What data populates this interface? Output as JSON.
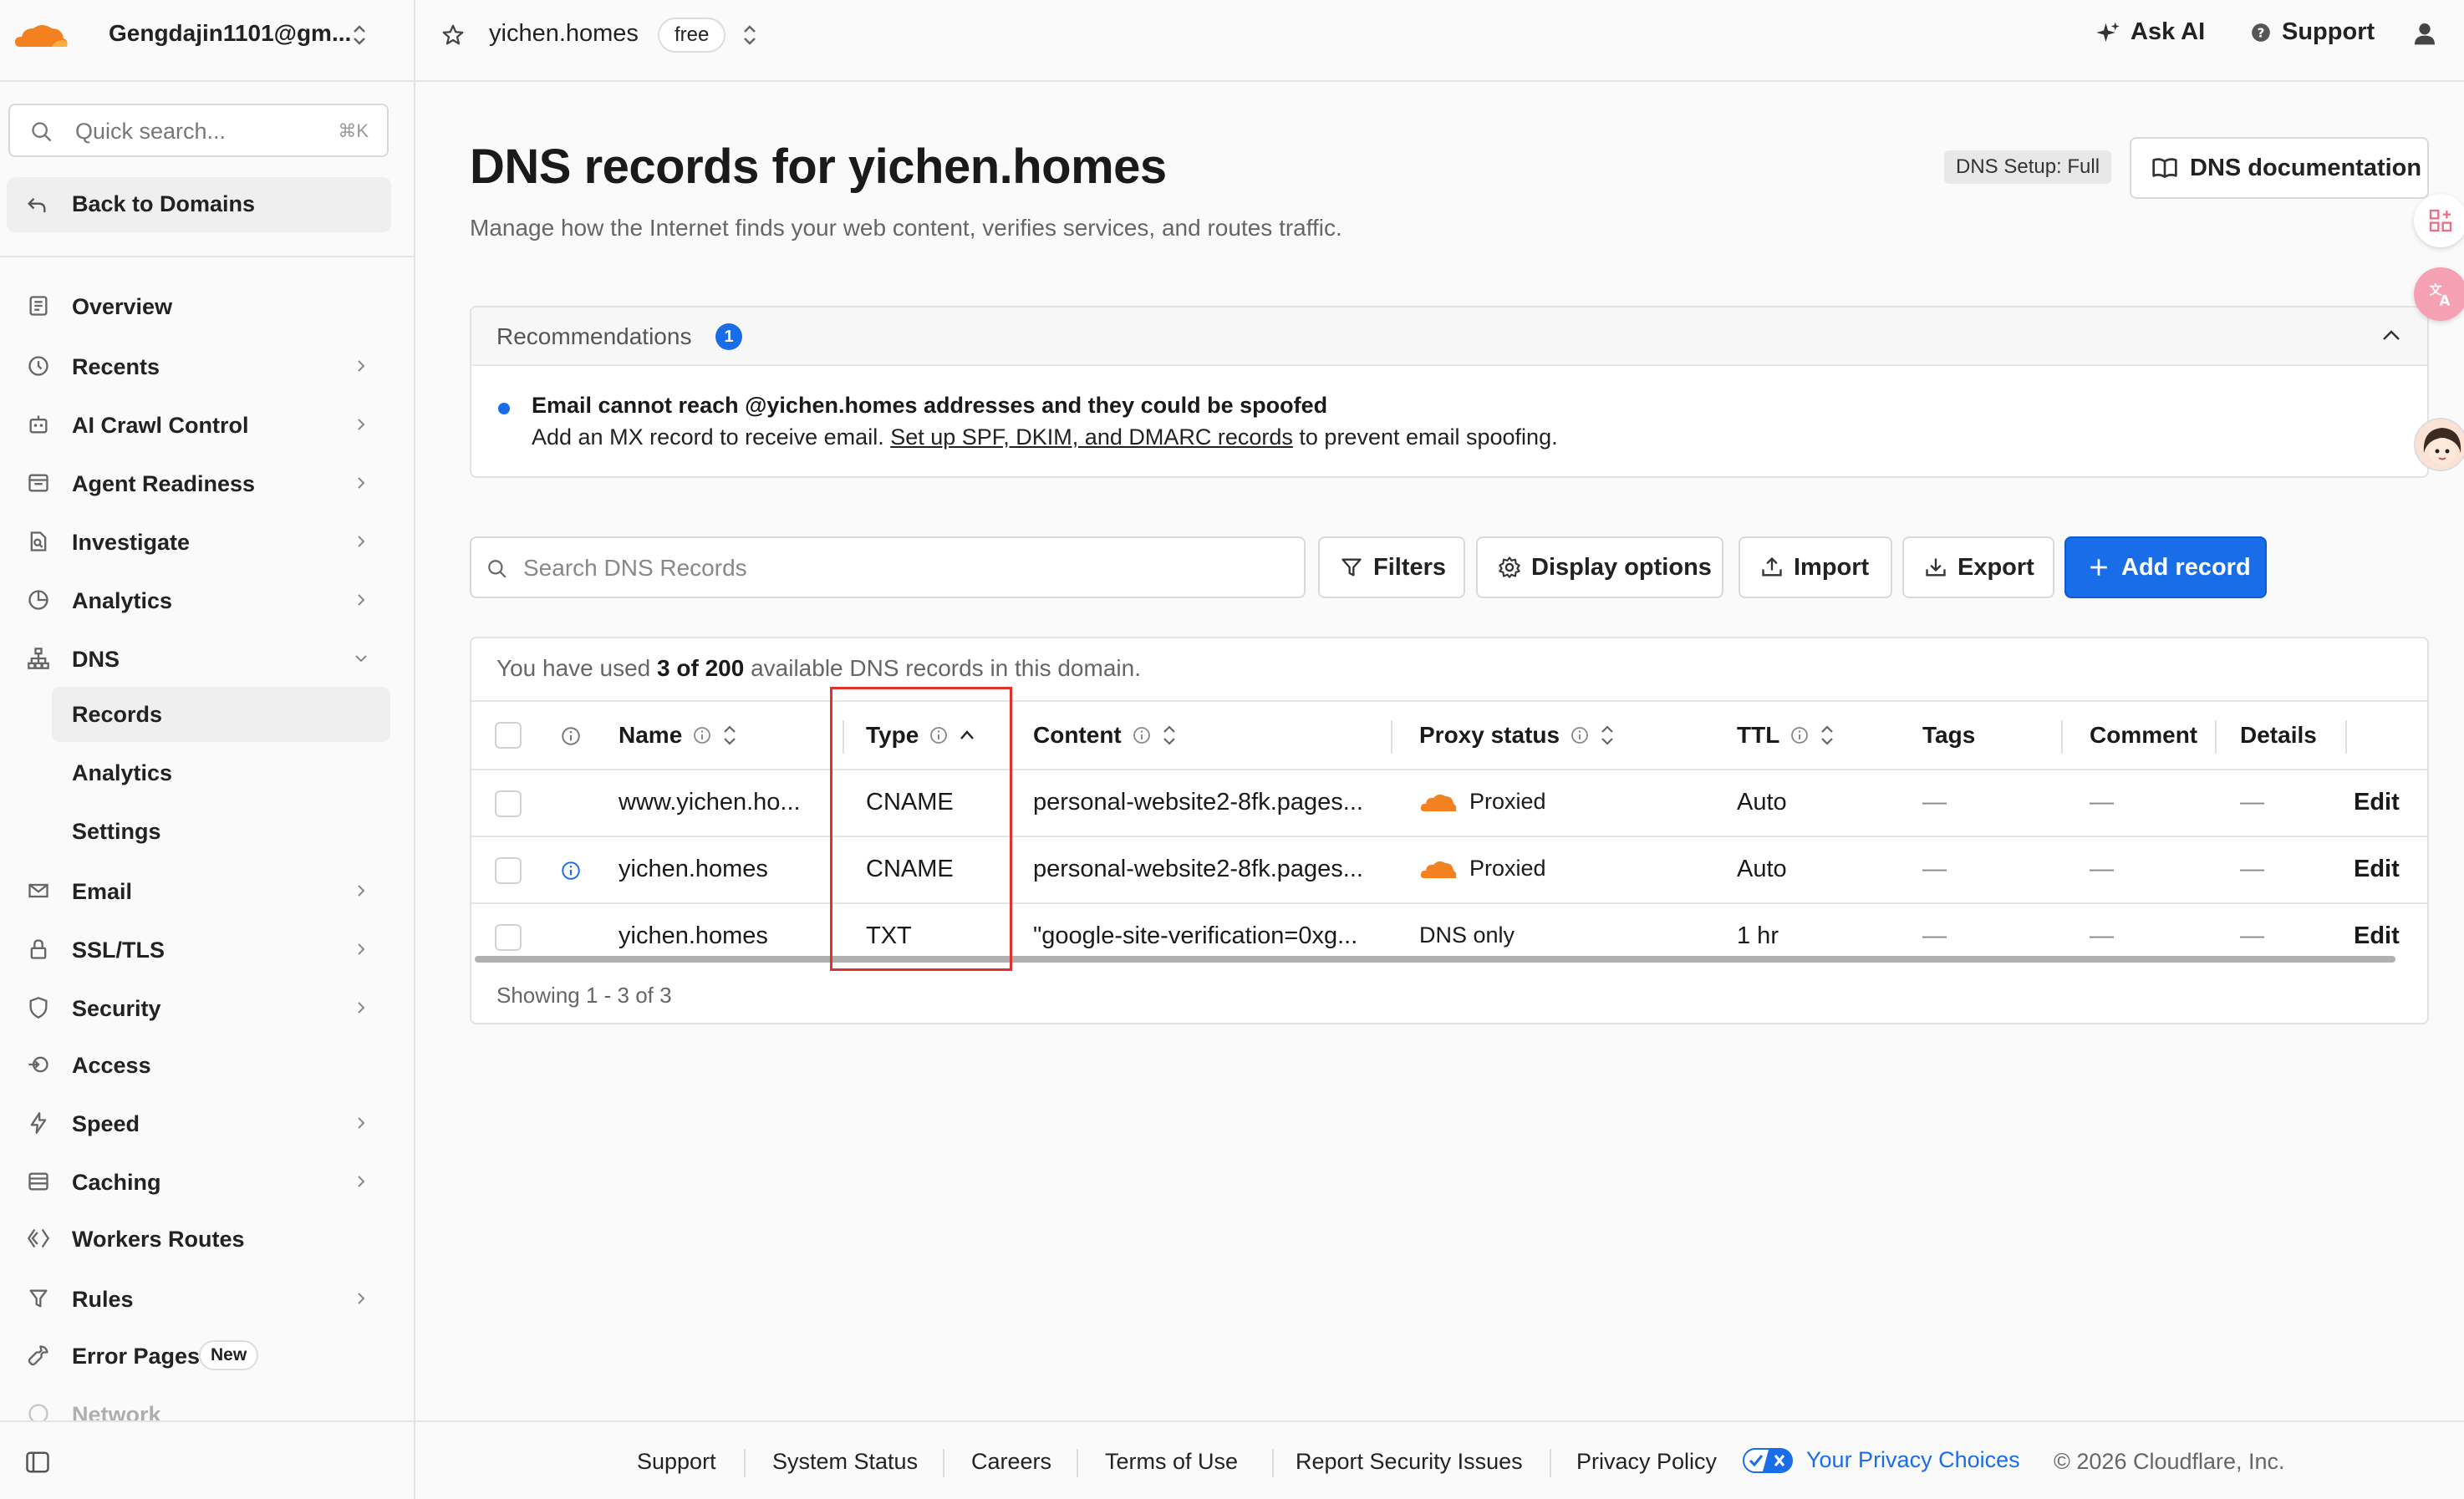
{
  "header": {
    "account_name": "Gengdajin1101@gm...",
    "zone_name": "yichen.homes",
    "plan": "free",
    "ask_ai": "Ask AI",
    "support": "Support"
  },
  "sidebar": {
    "search_placeholder": "Quick search...",
    "search_shortcut": "⌘K",
    "back_label": "Back to Domains",
    "items": [
      {
        "label": "Overview",
        "icon": "overview-icon"
      },
      {
        "label": "Recents",
        "icon": "clock-icon"
      },
      {
        "label": "AI Crawl Control",
        "icon": "robot-icon"
      },
      {
        "label": "Agent Readiness",
        "icon": "agent-icon"
      },
      {
        "label": "Investigate",
        "icon": "investigate-icon"
      },
      {
        "label": "Analytics",
        "icon": "pie-chart-icon"
      },
      {
        "label": "DNS",
        "icon": "network-icon"
      },
      {
        "label": "Email",
        "icon": "email-icon"
      },
      {
        "label": "SSL/TLS",
        "icon": "lock-icon"
      },
      {
        "label": "Security",
        "icon": "shield-icon"
      },
      {
        "label": "Access",
        "icon": "access-icon"
      },
      {
        "label": "Speed",
        "icon": "lightning-icon"
      },
      {
        "label": "Caching",
        "icon": "database-icon"
      },
      {
        "label": "Workers Routes",
        "icon": "workers-icon"
      },
      {
        "label": "Rules",
        "icon": "rules-icon"
      },
      {
        "label": "Error Pages",
        "icon": "wrench-icon"
      },
      {
        "label": "Network",
        "icon": "network-icon"
      }
    ],
    "dns_sub": [
      "Records",
      "Analytics",
      "Settings"
    ],
    "new_badge": "New"
  },
  "main": {
    "title": "DNS records for yichen.homes",
    "subtitle": "Manage how the Internet finds your web content, verifies services, and routes traffic.",
    "dns_setup": "DNS Setup: Full",
    "dns_doc": "DNS documentation",
    "recommendations": {
      "title": "Recommendations",
      "count": "1",
      "message": "Email cannot reach @yichen.homes addresses and they could be spoofed",
      "desc_prefix": "Add an MX record to receive email.",
      "desc_link": "Set up SPF, DKIM, and DMARC records",
      "desc_suffix": "to prevent email spoofing."
    },
    "toolbar": {
      "search_placeholder": "Search DNS Records",
      "filters": "Filters",
      "display_options": "Display options",
      "import": "Import",
      "export": "Export",
      "add_record": "Add record"
    },
    "usage": {
      "prefix": "You have used",
      "used": "3 of 200",
      "suffix": "available DNS records in this domain."
    },
    "columns": {
      "name": "Name",
      "type": "Type",
      "content": "Content",
      "proxy": "Proxy status",
      "ttl": "TTL",
      "tags": "Tags",
      "comment": "Comment",
      "details": "Details"
    },
    "rows": [
      {
        "name": "www.yichen.ho...",
        "type": "CNAME",
        "content": "personal-website2-8fk.pages...",
        "proxy": "Proxied",
        "ttl": "Auto",
        "tags": "—",
        "comment": "—",
        "details": "—",
        "action": "Edit"
      },
      {
        "name": "yichen.homes",
        "type": "CNAME",
        "content": "personal-website2-8fk.pages...",
        "proxy": "Proxied",
        "ttl": "Auto",
        "tags": "—",
        "comment": "—",
        "details": "—",
        "action": "Edit"
      },
      {
        "name": "yichen.homes",
        "type": "TXT",
        "content": "\"google-site-verification=0xg...",
        "proxy": "DNS only",
        "ttl": "1 hr",
        "tags": "—",
        "comment": "—",
        "details": "—",
        "action": "Edit"
      }
    ],
    "showing": "Showing 1 - 3 of 3"
  },
  "footer": {
    "links": [
      "Support",
      "System Status",
      "Careers",
      "Terms of Use",
      "Report Security Issues",
      "Privacy Policy"
    ],
    "privacy_choices": "Your Privacy Choices",
    "copyright": "© 2026 Cloudflare, Inc."
  },
  "colors": {
    "accent": "#1a6de8",
    "cloud_orange": "#f48120",
    "highlight": "#e0322a"
  }
}
